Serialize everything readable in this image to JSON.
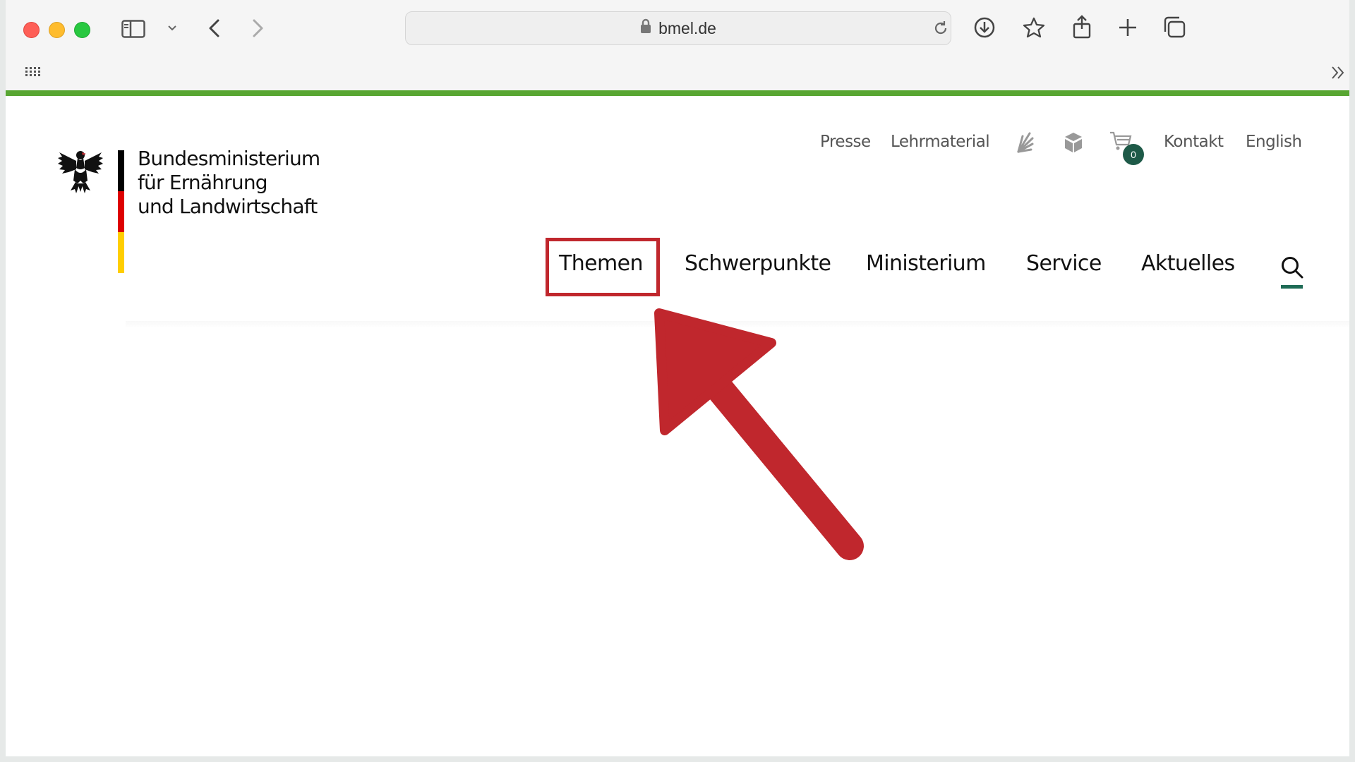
{
  "browser": {
    "url": "bmel.de"
  },
  "header": {
    "ministry_name": [
      "Bundesministerium",
      "für Ernährung",
      "und Landwirtschaft"
    ],
    "meta_nav": {
      "presse": "Presse",
      "lehrmaterial": "Lehrmaterial",
      "cart_count": "0",
      "kontakt": "Kontakt",
      "english": "English"
    },
    "main_nav": [
      "Themen",
      "Schwerpunkte",
      "Ministerium",
      "Service",
      "Aktuelles"
    ]
  },
  "colors": {
    "accent_green": "#58a632",
    "dark_green": "#1e5a48",
    "highlight_red": "#c0272d"
  }
}
